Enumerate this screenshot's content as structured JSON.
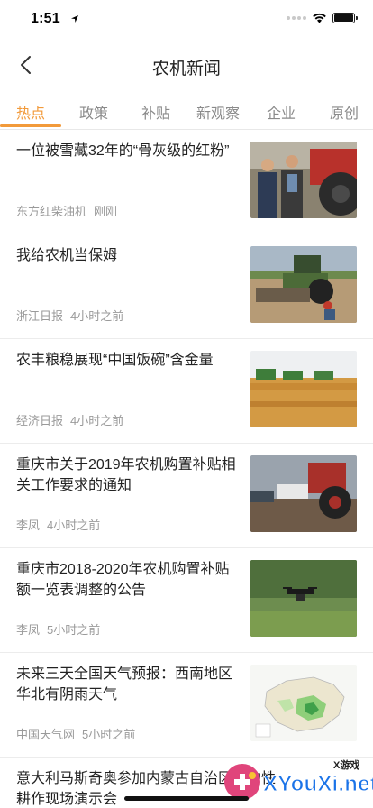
{
  "status": {
    "time": "1:51"
  },
  "header": {
    "title": "农机新闻"
  },
  "tabs": [
    {
      "label": "热点",
      "active": true
    },
    {
      "label": "政策",
      "active": false
    },
    {
      "label": "补贴",
      "active": false
    },
    {
      "label": "新观察",
      "active": false
    },
    {
      "label": "企业",
      "active": false
    },
    {
      "label": "原创",
      "active": false
    }
  ],
  "news": [
    {
      "title": "一位被雪藏32年的“骨灰级的红粉”",
      "source": "东方红柴油机",
      "time": "刚刚",
      "thumb": "tractor-men-photo"
    },
    {
      "title": "我给农机当保姆",
      "source": "浙江日报",
      "time": "4小时之前",
      "thumb": "tractor-field-photo"
    },
    {
      "title": "农丰粮稳展现“中国饭碗”含金量",
      "source": "经济日报",
      "time": "4小时之前",
      "thumb": "wheat-harvest-photo"
    },
    {
      "title": "重庆市关于2019年农机购置补贴相关工作要求的通知",
      "source": "李凤",
      "time": "4小时之前",
      "thumb": "red-tractor-photo"
    },
    {
      "title": "重庆市2018-2020年农机购置补贴额一览表调整的公告",
      "source": "李凤",
      "time": "5小时之前",
      "thumb": "drone-field-photo"
    },
    {
      "title": "未来三天全国天气预报：西南地区华北有阴雨天气",
      "source": "中国天气网",
      "time": "5小时之前",
      "thumb": "weather-map"
    },
    {
      "title": "意大利马斯奇奥参加内蒙古自治区保护性耕作现场演示会"
    }
  ],
  "watermark": {
    "text": "XYouXi.net",
    "tag": "X游戏"
  },
  "colors": {
    "accent": "#f29a3a",
    "text": "#222222",
    "meta": "#9a9a9a",
    "divider": "#ececec"
  }
}
